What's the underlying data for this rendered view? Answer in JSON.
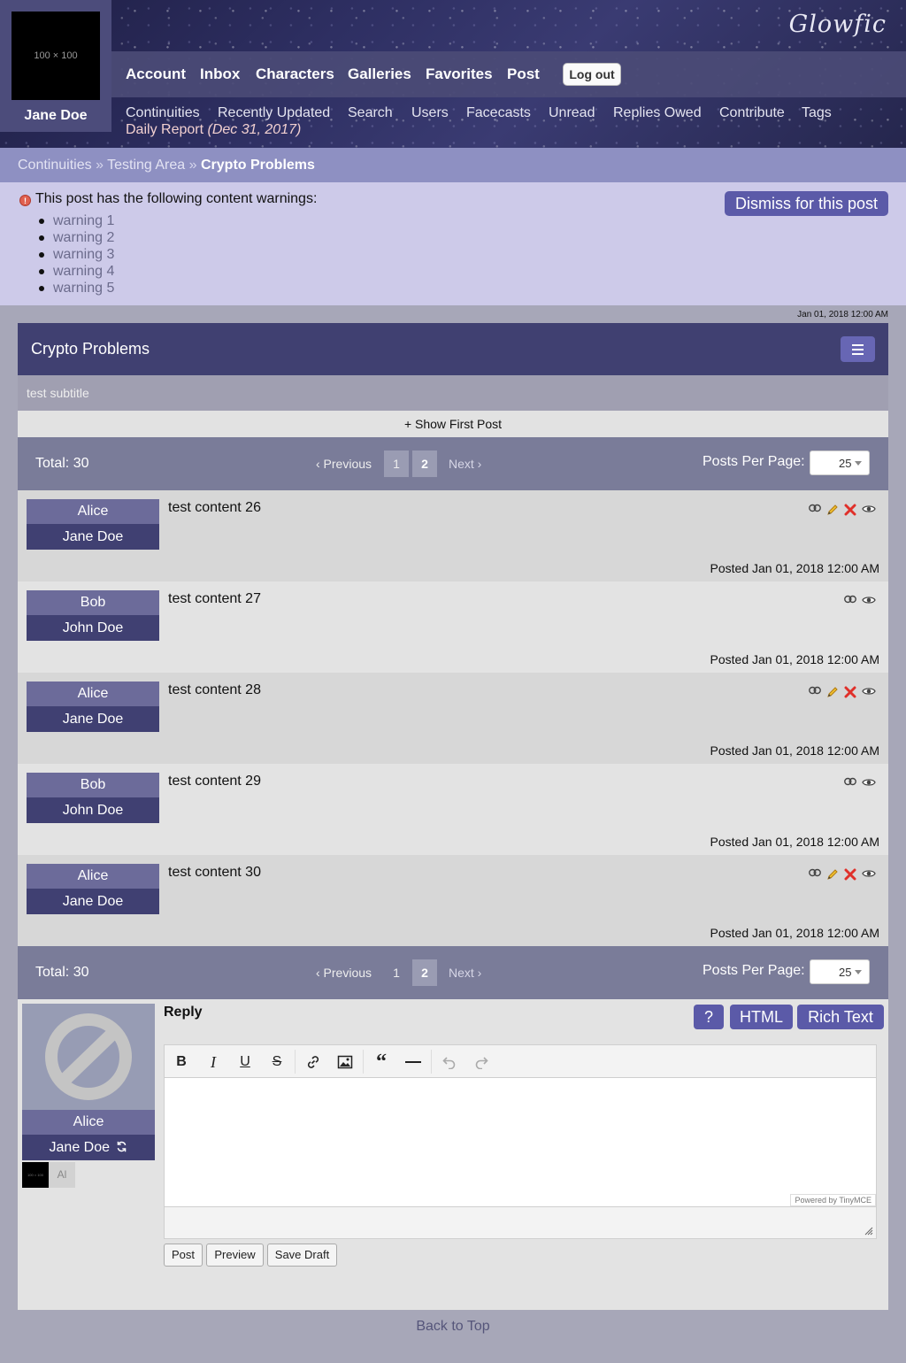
{
  "header": {
    "logo": "Glowfic",
    "user": {
      "avatar_text": "100 × 100",
      "name": "Jane Doe"
    },
    "nav": [
      "Account",
      "Inbox",
      "Characters",
      "Galleries",
      "Favorites",
      "Post"
    ],
    "logout": "Log out",
    "subnav": [
      "Continuities",
      "Recently Updated",
      "Search",
      "Users",
      "Facecasts",
      "Unread",
      "Replies Owed",
      "Contribute",
      "Tags"
    ],
    "daily_report": {
      "label": "Daily Report",
      "date": "(Dec 31, 2017)"
    }
  },
  "breadcrumbs": {
    "items": [
      "Continuities",
      "Testing Area"
    ],
    "current": "Crypto Problems",
    "separator": "»"
  },
  "warnings": {
    "title": "This post has the following content warnings:",
    "icon": "alert-icon",
    "items": [
      "warning 1",
      "warning 2",
      "warning 3",
      "warning 4",
      "warning 5"
    ],
    "dismiss": "Dismiss for this post"
  },
  "post": {
    "timestamp": "Jan 01, 2018 12:00 AM",
    "title": "Crypto Problems",
    "subtitle": "test subtitle",
    "show_first": "+ Show First Post"
  },
  "pagination": {
    "total": "Total: 30",
    "prev": "‹ Previous",
    "pages": [
      "1",
      "2"
    ],
    "current": "2",
    "next": "Next ›",
    "per_page_label": "Posts Per Page:",
    "per_page_value": "25"
  },
  "replies": [
    {
      "character": "Alice",
      "user": "Jane Doe",
      "content": "test content 26",
      "posted": "Posted Jan 01, 2018 12:00 AM",
      "icons": [
        "link-icon",
        "edit-icon",
        "delete-icon",
        "view-icon"
      ]
    },
    {
      "character": "Bob",
      "user": "John Doe",
      "content": "test content 27",
      "posted": "Posted Jan 01, 2018 12:00 AM",
      "icons": [
        "link-icon",
        "view-icon"
      ]
    },
    {
      "character": "Alice",
      "user": "Jane Doe",
      "content": "test content 28",
      "posted": "Posted Jan 01, 2018 12:00 AM",
      "icons": [
        "link-icon",
        "edit-icon",
        "delete-icon",
        "view-icon"
      ]
    },
    {
      "character": "Bob",
      "user": "John Doe",
      "content": "test content 29",
      "posted": "Posted Jan 01, 2018 12:00 AM",
      "icons": [
        "link-icon",
        "view-icon"
      ]
    },
    {
      "character": "Alice",
      "user": "Jane Doe",
      "content": "test content 30",
      "posted": "Posted Jan 01, 2018 12:00 AM",
      "icons": [
        "link-icon",
        "edit-icon",
        "delete-icon",
        "view-icon"
      ]
    }
  ],
  "reply_form": {
    "label": "Reply",
    "character": "Alice",
    "user": "Jane Doe",
    "mini_icon_text": "100 × 100",
    "alias": "Al",
    "buttons": [
      "?",
      "HTML",
      "Rich Text"
    ],
    "powered_by": "Powered by TinyMCE",
    "actions": [
      "Post",
      "Preview",
      "Save Draft"
    ]
  },
  "colors": {
    "header_bg": "#2e2f62",
    "accent": "#5b5aa8",
    "nav_bar": "#4b4b76",
    "character": "#6c6b9a",
    "user": "#404072",
    "warnings_bg": "#cdcae9",
    "paginator_bg": "#7a7c99"
  },
  "footer": {
    "back_to_top": "Back to Top"
  }
}
